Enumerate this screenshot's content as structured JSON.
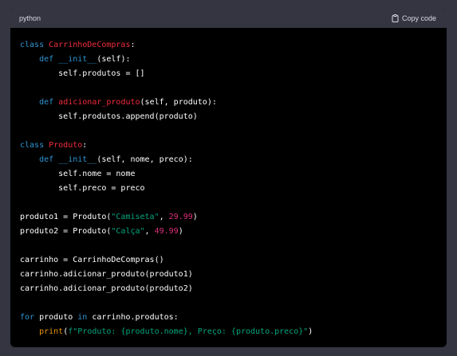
{
  "header": {
    "language": "python",
    "copy_label": "Copy code"
  },
  "code": {
    "lines": [
      [
        {
          "t": "class ",
          "c": "kw"
        },
        {
          "t": "CarrinhoDeCompras",
          "c": "cls"
        },
        {
          "t": ":",
          "c": ""
        }
      ],
      [
        {
          "t": "    def ",
          "c": "kw"
        },
        {
          "t": "__init__",
          "c": "kw"
        },
        {
          "t": "(self):",
          "c": ""
        }
      ],
      [
        {
          "t": "        self.produtos = []",
          "c": ""
        }
      ],
      [],
      [
        {
          "t": "    def ",
          "c": "kw"
        },
        {
          "t": "adicionar_produto",
          "c": "fn"
        },
        {
          "t": "(self, produto):",
          "c": ""
        }
      ],
      [
        {
          "t": "        self.produtos.append(produto)",
          "c": ""
        }
      ],
      [],
      [
        {
          "t": "class ",
          "c": "kw"
        },
        {
          "t": "Produto",
          "c": "cls"
        },
        {
          "t": ":",
          "c": ""
        }
      ],
      [
        {
          "t": "    def ",
          "c": "kw"
        },
        {
          "t": "__init__",
          "c": "kw"
        },
        {
          "t": "(self, nome, preco):",
          "c": ""
        }
      ],
      [
        {
          "t": "        self.nome = nome",
          "c": ""
        }
      ],
      [
        {
          "t": "        self.preco = preco",
          "c": ""
        }
      ],
      [],
      [
        {
          "t": "produto1 = Produto(",
          "c": ""
        },
        {
          "t": "\"Camiseta\"",
          "c": "str"
        },
        {
          "t": ", ",
          "c": ""
        },
        {
          "t": "29.99",
          "c": "num"
        },
        {
          "t": ")",
          "c": ""
        }
      ],
      [
        {
          "t": "produto2 = Produto(",
          "c": ""
        },
        {
          "t": "\"Calça\"",
          "c": "str"
        },
        {
          "t": ", ",
          "c": ""
        },
        {
          "t": "49.99",
          "c": "num"
        },
        {
          "t": ")",
          "c": ""
        }
      ],
      [],
      [
        {
          "t": "carrinho = CarrinhoDeCompras()",
          "c": ""
        }
      ],
      [
        {
          "t": "carrinho.adicionar_produto(produto1)",
          "c": ""
        }
      ],
      [
        {
          "t": "carrinho.adicionar_produto(produto2)",
          "c": ""
        }
      ],
      [],
      [
        {
          "t": "for ",
          "c": "kw"
        },
        {
          "t": "produto ",
          "c": ""
        },
        {
          "t": "in ",
          "c": "kw"
        },
        {
          "t": "carrinho.produtos:",
          "c": ""
        }
      ],
      [
        {
          "t": "    ",
          "c": ""
        },
        {
          "t": "print",
          "c": "builtin"
        },
        {
          "t": "(",
          "c": ""
        },
        {
          "t": "f\"Produto: {produto.nome}, Preço: {produto.preco}\"",
          "c": "str"
        },
        {
          "t": ")",
          "c": ""
        }
      ]
    ]
  }
}
